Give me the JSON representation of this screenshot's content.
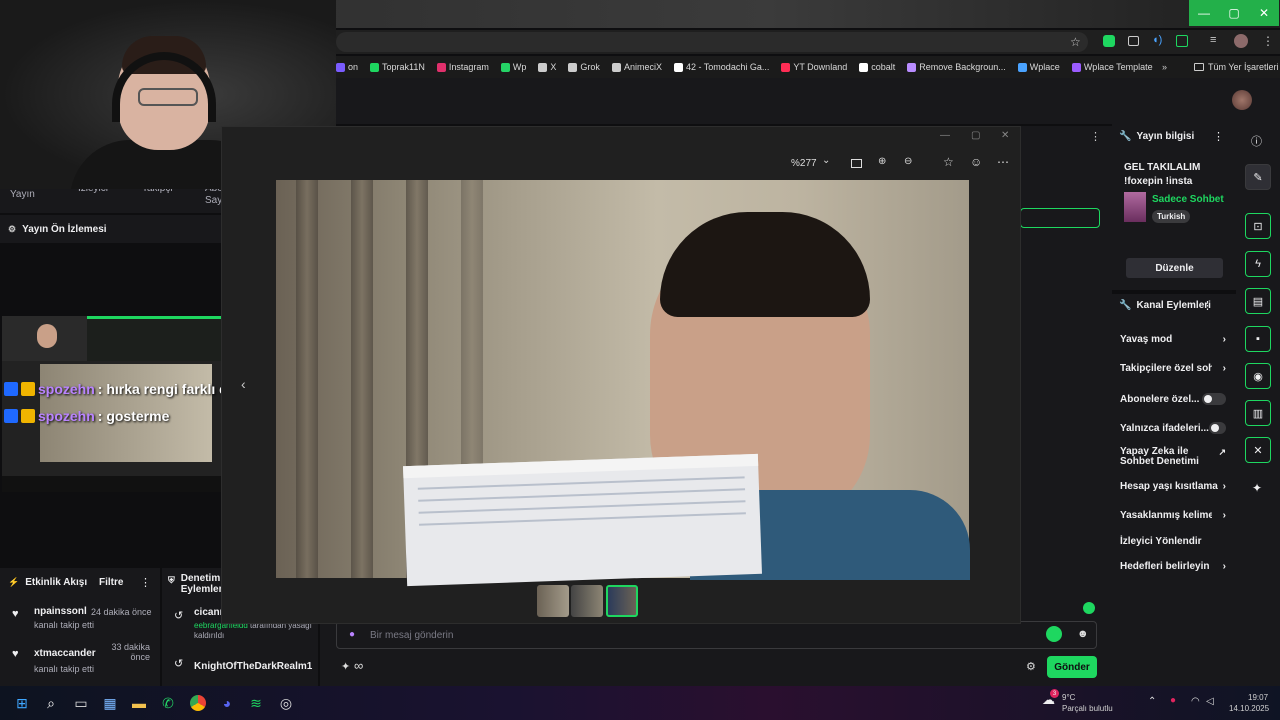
{
  "browser": {
    "bookmarks": [
      {
        "label": "on",
        "color": "#7a5cff"
      },
      {
        "label": "Toprak11N",
        "color": "#1ed760"
      },
      {
        "label": "Instagram",
        "color": "#e1306c"
      },
      {
        "label": "Wp",
        "color": "#25d366"
      },
      {
        "label": "X",
        "color": "#cccccc"
      },
      {
        "label": "Grok",
        "color": "#cccccc"
      },
      {
        "label": "AnimeciX",
        "color": "#cccccc"
      },
      {
        "label": "42 - Tomodachi Ga...",
        "color": "#ffffff"
      },
      {
        "label": "YT Downland",
        "color": "#ff2d55"
      },
      {
        "label": "cobalt",
        "color": "#ffffff"
      },
      {
        "label": "Remove Backgroun...",
        "color": "#b98cff"
      },
      {
        "label": "Wplace",
        "color": "#4aa3ff"
      },
      {
        "label": "Wplace Template",
        "color": "#9b5cff"
      }
    ],
    "all_bookmarks": "Tüm Yer İşaretleri",
    "more_bookmarks": "»"
  },
  "left": {
    "stats_labels": [
      "Yayın",
      "İzleyici",
      "Takipçi",
      "Abo Say"
    ],
    "preview_title": "Yayın Ön İzlemesi",
    "chat_overlay": [
      {
        "user": "spozehn",
        "message": " : hırka rengi farklı diye isim aldırlar"
      },
      {
        "user": "spozehn",
        "message": " : gosterme"
      }
    ]
  },
  "activity": {
    "title": "Etkinlik Akışı",
    "filter": "Filtre",
    "items": [
      {
        "name": "npainssonl",
        "time": "24 dakika önce",
        "action": "kanalı takip etti"
      },
      {
        "name": "xtmaccander",
        "time": "33 dakika önce",
        "action": "kanalı takip etti"
      }
    ]
  },
  "moderator": {
    "title": "Denetim Eylemleri",
    "items": [
      {
        "name": "cicanr",
        "detail_user": "eebrargarfieldd",
        "detail": " tarafından yasağı kaldırıldı"
      },
      {
        "name": "KnightOfTheDarkRealm1",
        "detail_user": "",
        "detail": ""
      }
    ]
  },
  "viewer": {
    "zoom": "%277",
    "zoom_caret": "⌄"
  },
  "chat": {
    "placeholder": "Bir mesaj gönderin",
    "send": "Gönder",
    "infinity": "∞"
  },
  "stream_info": {
    "title": "Yayın bilgisi",
    "stream_title": "GEL TAKILALIM !foxepin !insta",
    "category": "Sadece Sohbet",
    "language": "Turkish",
    "edit": "Düzenle"
  },
  "channel_actions": {
    "title": "Kanal Eylemleri",
    "items": [
      {
        "label": "Yavaş mod",
        "control": "chevron"
      },
      {
        "label": "Takipçilere özel soht",
        "control": "chevron"
      },
      {
        "label": "Abonelere özel...",
        "control": "toggle"
      },
      {
        "label": "Yalnızca ifadeleri...",
        "control": "toggle"
      },
      {
        "label": "Yapay Zeka ile Sohbet Denetimi",
        "control": "external"
      },
      {
        "label": "Hesap yaşı kısıtlama",
        "control": "chevron"
      },
      {
        "label": "Yasaklanmış kelimele",
        "control": "chevron"
      },
      {
        "label": "İzleyici Yönlendir",
        "control": "none"
      },
      {
        "label": "Hedefleri belirleyin",
        "control": "chevron"
      }
    ]
  },
  "taskbar": {
    "weather_temp": "9°C",
    "weather_desc": "Parçalı bulutlu",
    "weather_badge": "3",
    "time": "19:07",
    "date": "14.10.2025"
  },
  "colors": {
    "accent": "#1ed760",
    "twitch_purple": "#b983ff"
  }
}
